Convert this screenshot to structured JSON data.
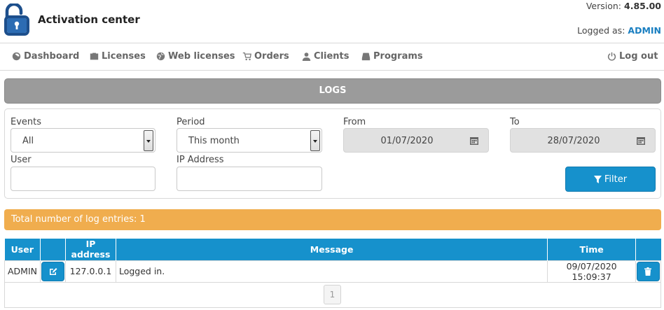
{
  "app": {
    "title": "Activation center",
    "version_label": "Version:",
    "version": "4.85.00",
    "logged_label": "Logged as:",
    "user": "ADMIN"
  },
  "nav": {
    "dashboard": "Dashboard",
    "licenses": "Licenses",
    "web_licenses": "Web licenses",
    "orders": "Orders",
    "clients": "Clients",
    "programs": "Programs",
    "logout": "Log out"
  },
  "logs_title": "LOGS",
  "filters": {
    "events_label": "Events",
    "events_value": "All",
    "period_label": "Period",
    "period_value": "This month",
    "from_label": "From",
    "from_value": "01/07/2020",
    "to_label": "To",
    "to_value": "28/07/2020",
    "user_label": "User",
    "user_value": "",
    "ip_label": "IP Address",
    "ip_value": "",
    "filter_button": "Filter"
  },
  "total_text": "Total number of log entries: 1",
  "table": {
    "headers": {
      "user": "User",
      "ip": "IP address",
      "message": "Message",
      "time": "Time"
    },
    "rows": [
      {
        "user": "ADMIN",
        "ip": "127.0.0.1",
        "message": "Logged in.",
        "time": "09/07/2020 15:09:37"
      }
    ]
  },
  "pagination": {
    "current_page": "1"
  },
  "colors": {
    "accent": "#1691cc",
    "warning": "#f0ad4e",
    "bar": "#9b9b9b"
  }
}
